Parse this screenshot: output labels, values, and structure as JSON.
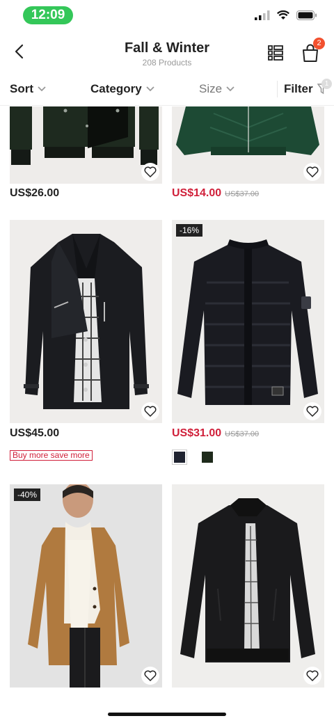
{
  "status": {
    "time": "12:09"
  },
  "header": {
    "title": "Fall & Winter",
    "subtitle": "208 Products",
    "cart_count": "2"
  },
  "filters": {
    "sort_label": "Sort",
    "category_label": "Category",
    "size_label": "Size",
    "filter_label": "Filter",
    "filter_count": "1"
  },
  "products": [
    {
      "price": "US$26.00"
    },
    {
      "price": "US$14.00",
      "original_price": "US$37.00"
    },
    {
      "price": "US$45.00",
      "promo": "Buy more save more"
    },
    {
      "price": "US$31.00",
      "original_price": "US$37.00",
      "discount": "-16%",
      "swatches": [
        "#1f2330",
        "#1e2a1b"
      ]
    },
    {
      "discount": "-40%"
    },
    {}
  ],
  "colors": {
    "sale": "#d0203a",
    "badge": "#f2502e",
    "status_pill": "#34c759"
  }
}
